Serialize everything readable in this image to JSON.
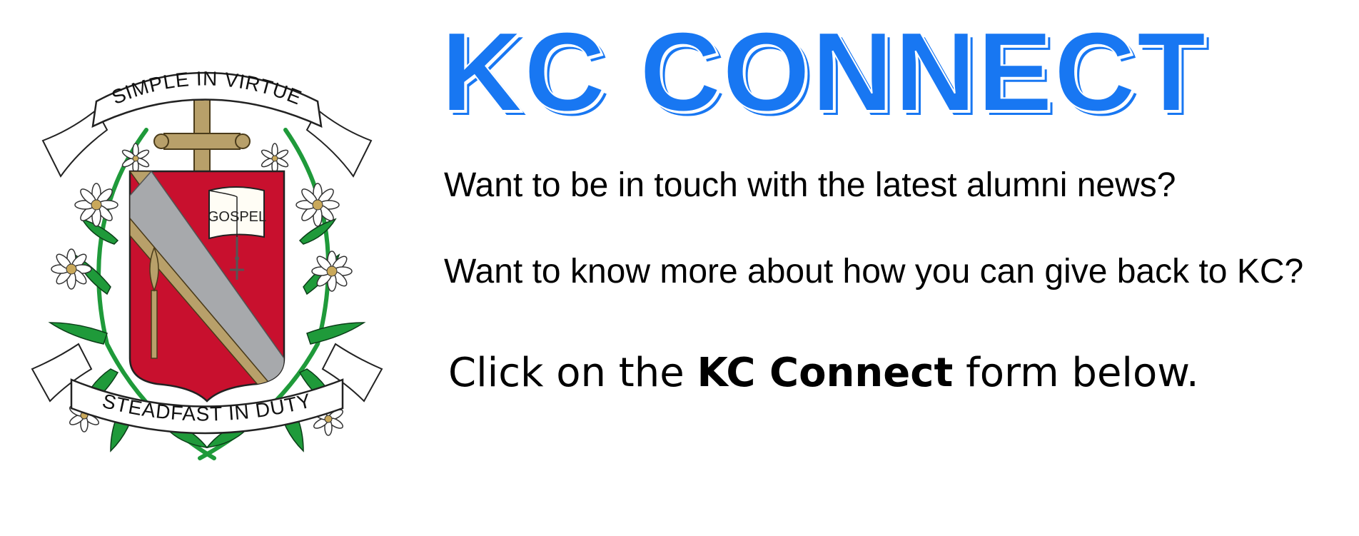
{
  "crest": {
    "motto_top": "SIMPLE IN VIRTUE",
    "motto_bottom": "STEADFAST IN DUTY",
    "book_text": "GOSPEL"
  },
  "title": "KC CONNECT",
  "line1": "Want to be in touch with the latest alumni news?",
  "line2": "Want to know more about how you can give back to KC?",
  "cta": {
    "prefix": "Click on the",
    "bold": "KC Connect",
    "suffix": "form below."
  },
  "colors": {
    "title_blue": "#1877f2",
    "shield_red": "#c8102e",
    "sash_gray": "#a7a9ac",
    "cross_gold": "#b8a06a",
    "leaf_green": "#1f9a3a"
  }
}
